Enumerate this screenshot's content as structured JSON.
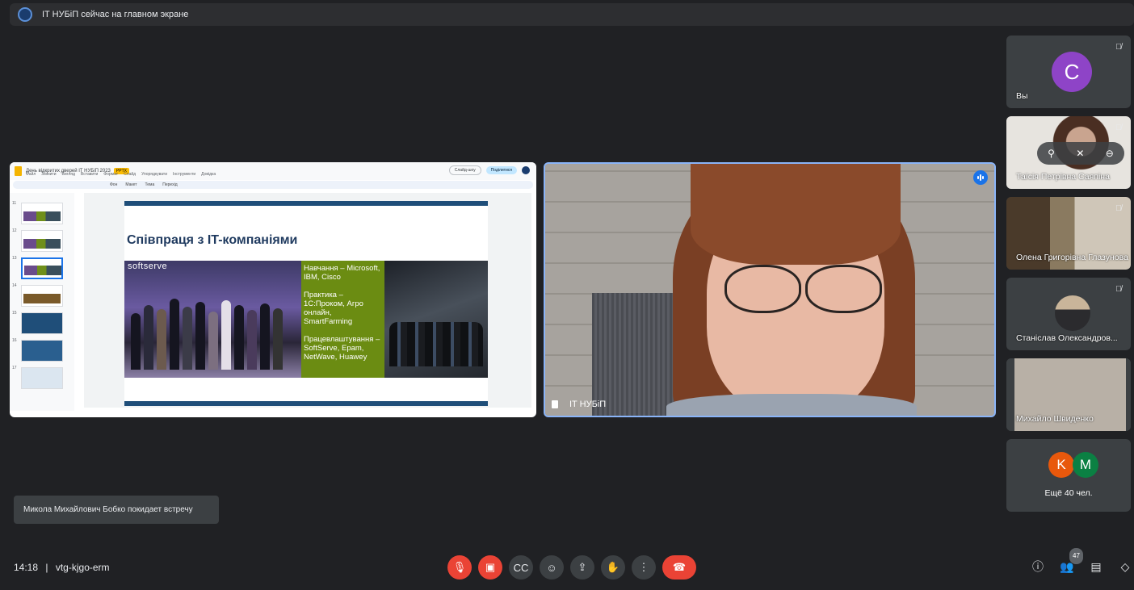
{
  "banner": {
    "text": "IT НУБіП сейчас на главном экране"
  },
  "presentation": {
    "doc_title": "День відкритих дверей IT НУБіП 2023",
    "badge": "PPTX",
    "menu": [
      "Файл",
      "Змінити",
      "Вигляд",
      "Вставити",
      "Формат",
      "Слайд",
      "Упорядкувати",
      "Інструменти",
      "Довідка"
    ],
    "slideshow_label": "Слайд-шоу",
    "share_label": "Поділитися",
    "toolbar": [
      "Фон",
      "Макет",
      "Тема",
      "Перехід"
    ],
    "slide_numbers": [
      "11",
      "12",
      "13",
      "14",
      "15",
      "16",
      "17"
    ],
    "slide": {
      "title": "Співпраця з IT-компаніями",
      "logo": "softserve",
      "lines": [
        "Навчання – Microsoft, IBM, Cisco",
        "Практика – 1С:Проком, Агро онлайн, SmartFarming",
        "Працевлаштування – SoftServe, Epam, NetWave, Huawey"
      ]
    }
  },
  "speaker": {
    "name": "IT НУБіП"
  },
  "participants": [
    {
      "name": "Вы",
      "initial": "C",
      "avatar_color": "#8e44c7"
    },
    {
      "name": "Таїсія Петрівна Саяпіна"
    },
    {
      "name": "Олена Григорівна Глазунова"
    },
    {
      "name": "Станіслав Олександров..."
    },
    {
      "name": "Михайло Швиденко"
    }
  ],
  "more": {
    "initials": [
      "K",
      "M"
    ],
    "colors": [
      "#e8580c",
      "#0b8043"
    ],
    "label": "Ещё 40 чел."
  },
  "toast": "Микола Михайлович Бобко покидает встречу",
  "footer": {
    "time": "14:18",
    "separator": "|",
    "meeting_code": "vtg-kjgo-erm",
    "people_count": "47"
  }
}
